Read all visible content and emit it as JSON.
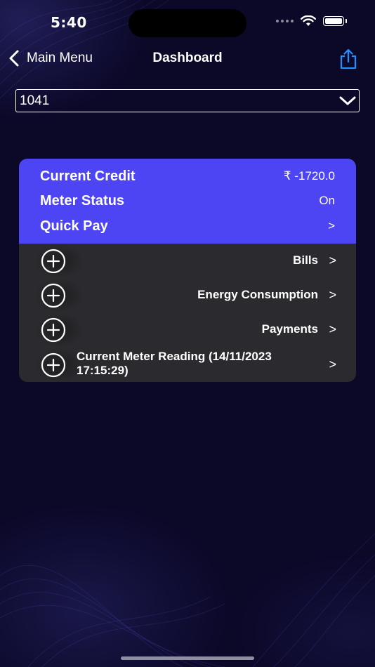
{
  "status_bar": {
    "time": "5:40"
  },
  "nav": {
    "back_label": "Main Menu",
    "title": "Dashboard",
    "icons": {
      "back": "chevron-left-icon",
      "share": "share-icon"
    },
    "accent_color": "#1e90ff"
  },
  "meter_select": {
    "selected": "1041"
  },
  "summary": {
    "background_color": "#4d44f3",
    "current_credit": {
      "label": "Current Credit",
      "value": "₹ -1720.0"
    },
    "meter_status": {
      "label": "Meter Status",
      "value": "On"
    },
    "quick_pay": {
      "label": "Quick Pay",
      "arrow": ">"
    }
  },
  "sections": [
    {
      "label": "Bills",
      "arrow": ">"
    },
    {
      "label": "Energy Consumption",
      "arrow": ">"
    },
    {
      "label": "Payments",
      "arrow": ">"
    },
    {
      "label": "Current Meter Reading (14/11/2023 17:15:29)",
      "arrow": ">"
    }
  ]
}
